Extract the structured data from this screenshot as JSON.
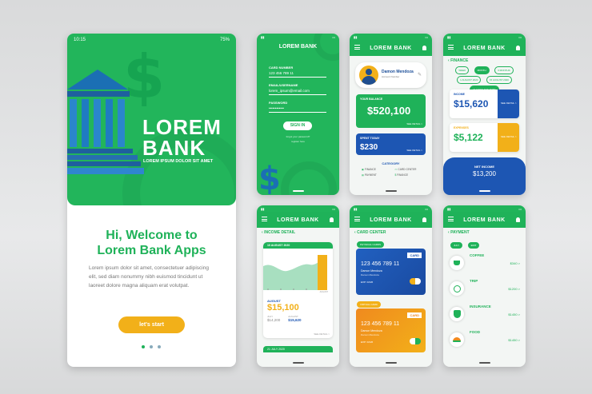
{
  "welcome": {
    "time": "10:15",
    "battery": "75%",
    "brand_line1": "LOREM",
    "brand_line2": "BANK",
    "brand_sub": "LOREM IPSUM DOLOR SIT AMET",
    "heading_line1": "Hi, Welcome to",
    "heading_line2": "Lorem Bank Apps",
    "body": "Lorem ipsum dolor sit amet, consectetuer adipiscing elit, sed diam nonummy nibh euismod tincidunt ut laoreet dolore magna aliquam erat volutpat.",
    "cta": "let's start"
  },
  "login": {
    "title": "LOREM BANK",
    "card_number_label": "CARD NUMBER",
    "card_number": "123 456 789 11",
    "email_label": "EMAIL/USERNAME",
    "email": "lorem_ipsum@email.com",
    "password_label": "PASSWORD",
    "password": "••••••••••••",
    "sign_in": "SIGN IN",
    "forgot": "forgot your password?",
    "register": "register here"
  },
  "dashboard": {
    "title": "LOREM BANK",
    "user_name": "Damon Mendoza",
    "user_sub": "Account Number",
    "balance_label": "YOUR BALANCE",
    "balance": "$520,100",
    "balance_more": "SEE DETAIL >",
    "spent_label": "SPENT TODAY",
    "spent": "$230",
    "spent_more": "SEE DETAIL >",
    "category_label": "CATEGORY",
    "categories": [
      "FINANCE",
      "CARD CENTER",
      "PAYMENT",
      "FINANCE"
    ]
  },
  "finance": {
    "title": "LOREM BANK",
    "section": "FINANCE",
    "filters": [
      "WEEK",
      "MONTH",
      "3 MONTHS",
      "1 AUGUST 2020",
      "15 AUGUST 2020",
      "CHANGE THE DATE"
    ],
    "income_label": "INCOME",
    "income": "$15,620",
    "expenses_label": "EXPENSES",
    "expenses": "$5,122",
    "see_detail": "SEE DETAIL >",
    "net_label": "NET INCOME",
    "net": "$13,200"
  },
  "income_detail": {
    "title": "LOREM BANK",
    "section": "INCOME DETAIL",
    "date_bar": "10 AUGUST 2020",
    "chart_months": [
      "",
      "",
      "",
      "",
      "AUGUST"
    ],
    "month_label": "AUGUST",
    "amount": "$15,100",
    "col1_label": "JULY",
    "col1_value": "$14,200",
    "col2_label": "AUGUST",
    "col2_value": "$15,620",
    "see_detail": "SEE DETAIL >",
    "date_bar2": "21 JULY 2020"
  },
  "card_center": {
    "title": "LOREM BANK",
    "section": "CARD CENTER",
    "physical": "PHYSICAL CARDS",
    "card1_brand": "CARD",
    "card1_number": "123 456 789 11",
    "card1_holder": "Damon Mendoza",
    "card1_sub": "Damon Mendoza",
    "card1_exp": "EXP: 02/26",
    "virtual": "VIRTUAL CARD",
    "card2_brand": "CARD",
    "card2_number": "123 456 789 11",
    "card2_holder": "Damon Mendoza",
    "card2_sub": "Damon Mendoza",
    "card2_exp": "EXP: 02/26"
  },
  "payment": {
    "title": "LOREM BANK",
    "section": "PAYMENT",
    "tabs": [
      "JULY",
      "EDIT"
    ],
    "items": [
      {
        "name": "COFFEE",
        "amount": "$340 >"
      },
      {
        "name": "TRIP",
        "amount": "$1200 >"
      },
      {
        "name": "INSURANCE",
        "amount": "$1450 >"
      },
      {
        "name": "FOOD",
        "amount": "$1450 >"
      }
    ]
  }
}
